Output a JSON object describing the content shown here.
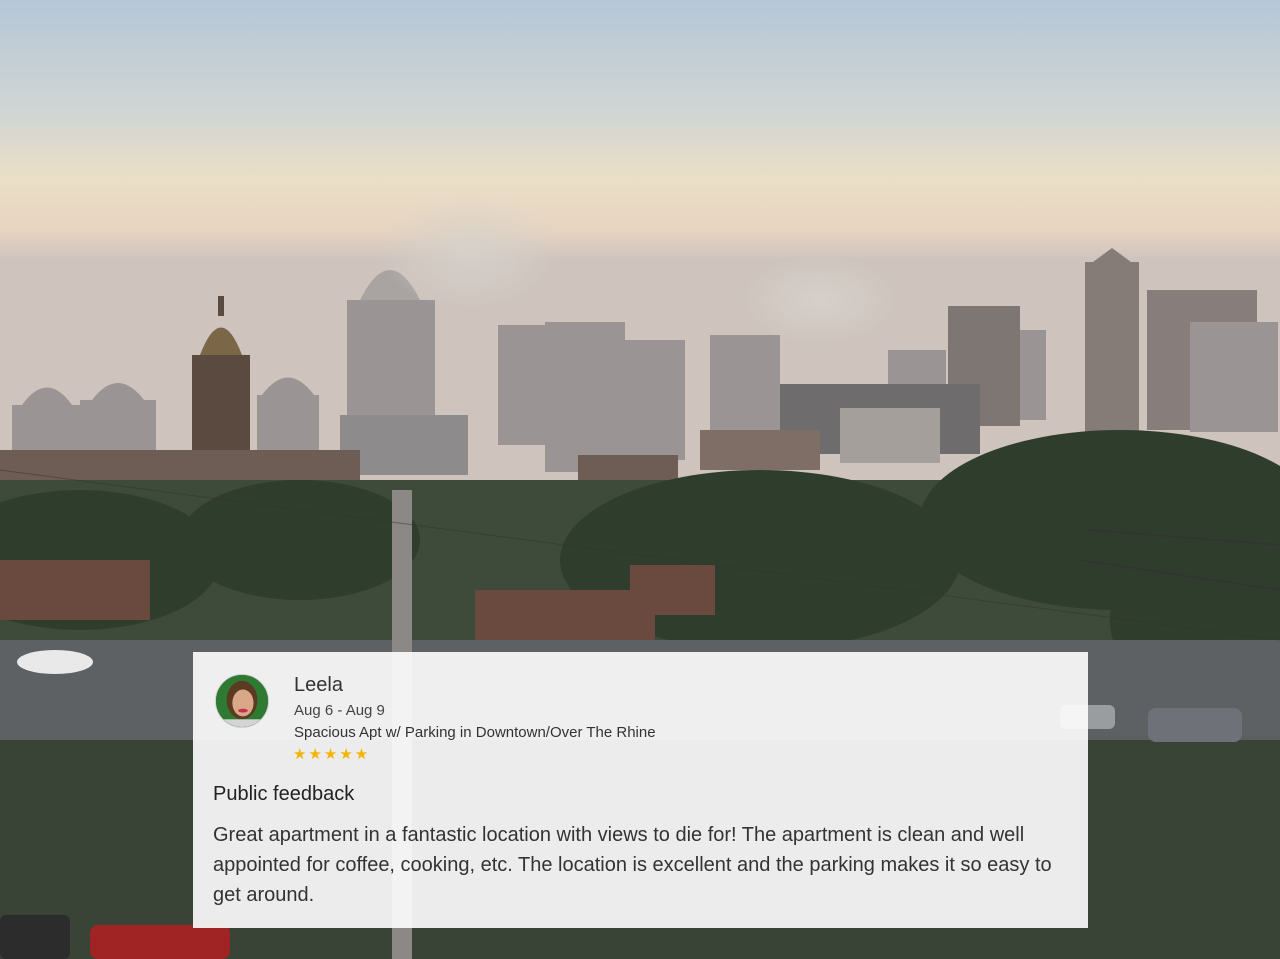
{
  "review": {
    "reviewer_name": "Leela",
    "dates": "Aug 6 - Aug 9",
    "listing_title": "Spacious Apt w/ Parking in Downtown/Over The Rhine",
    "stars": "★★★★★",
    "rating": 5,
    "section_heading": "Public feedback",
    "feedback_text": "Great apartment in a fantastic location with views to die for! The apartment is clean and well appointed for coffee, cooking, etc. The location is excellent and the parking makes it so easy to get around."
  },
  "colors": {
    "star": "#f4b400",
    "card_background": "#ffffff"
  }
}
